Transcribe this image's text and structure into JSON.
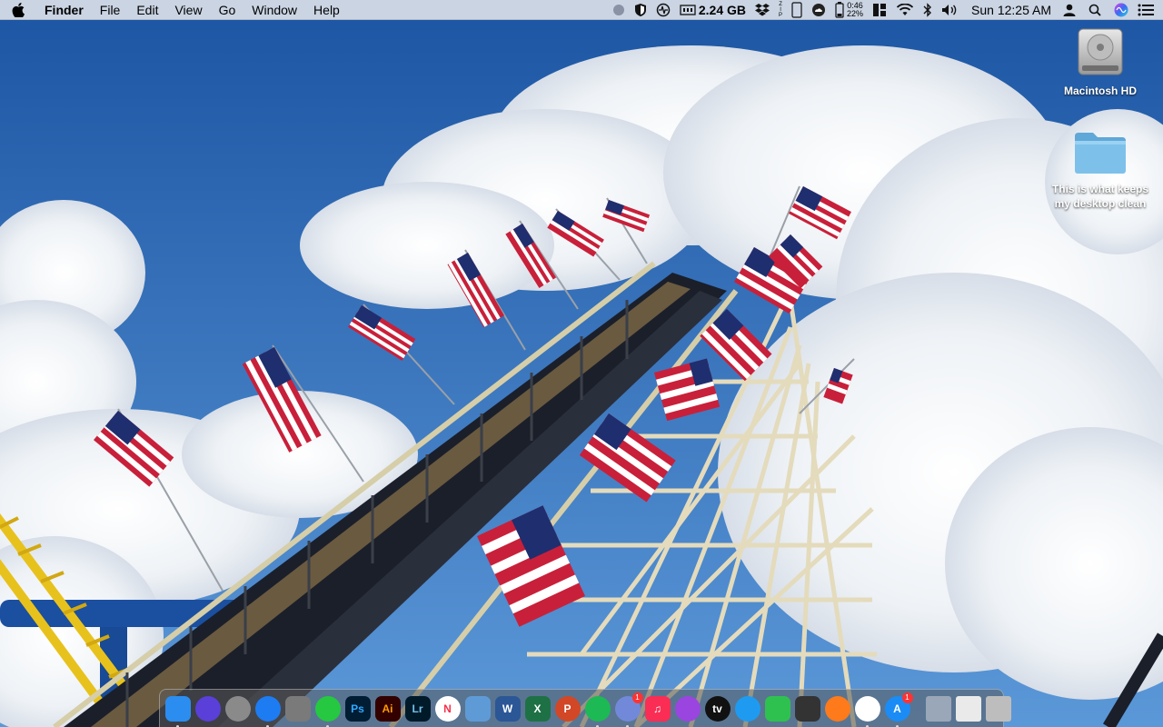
{
  "menubar": {
    "app_name": "Finder",
    "menus": [
      "File",
      "Edit",
      "View",
      "Go",
      "Window",
      "Help"
    ],
    "memory": "2.24 GB",
    "battery_time": "0:46",
    "battery_percent": "22%",
    "clock": "Sun 12:25 AM",
    "status_icons": [
      "record-icon",
      "shield-icon",
      "activity-monitor-icon",
      "memory-icon",
      "dropbox-icon",
      "zip-icon",
      "phone-icon",
      "cloud-sync-icon",
      "battery-icon",
      "window-grid-icon",
      "wifi-icon",
      "bluetooth-icon",
      "volume-icon",
      "user-icon",
      "spotlight-search-icon",
      "siri-icon",
      "notification-center-icon"
    ]
  },
  "desktop": {
    "drive_label": "Macintosh HD",
    "folder_label": "This is what keeps\nmy desktop clean"
  },
  "dock": {
    "apps": [
      {
        "name": "finder",
        "glyph": "",
        "bg": "#2b8df0",
        "running": true
      },
      {
        "name": "siri",
        "glyph": "",
        "bg": "#5a3fd8",
        "running": false,
        "circle": true
      },
      {
        "name": "launchpad",
        "glyph": "",
        "bg": "#8a8a8a",
        "running": false,
        "circle": true
      },
      {
        "name": "safari",
        "glyph": "",
        "bg": "#1d7cf2",
        "running": true,
        "circle": true
      },
      {
        "name": "system-preferences",
        "glyph": "",
        "bg": "#7a7a7a",
        "running": false
      },
      {
        "name": "cloud-app",
        "glyph": "",
        "bg": "#25c840",
        "running": true,
        "circle": true
      },
      {
        "name": "photoshop",
        "glyph": "Ps",
        "bg": "#001d34",
        "fg": "#31a8ff",
        "running": false
      },
      {
        "name": "illustrator",
        "glyph": "Ai",
        "bg": "#330000",
        "fg": "#ff9a00",
        "running": false
      },
      {
        "name": "lightroom",
        "glyph": "Lr",
        "bg": "#001a2a",
        "fg": "#74c0e8",
        "running": false
      },
      {
        "name": "news",
        "glyph": "N",
        "bg": "#ffffff",
        "fg": "#f5304a",
        "running": false,
        "circle": true
      },
      {
        "name": "preview",
        "glyph": "",
        "bg": "#5e9bd6",
        "running": false
      },
      {
        "name": "word",
        "glyph": "W",
        "bg": "#2b5797",
        "running": false
      },
      {
        "name": "excel",
        "glyph": "X",
        "bg": "#1e7145",
        "running": false
      },
      {
        "name": "powerpoint",
        "glyph": "P",
        "bg": "#d24726",
        "running": false,
        "circle": true
      },
      {
        "name": "spotify",
        "glyph": "",
        "bg": "#1db954",
        "running": true,
        "circle": true
      },
      {
        "name": "discord",
        "glyph": "",
        "bg": "#7289da",
        "running": true,
        "circle": true,
        "badge": "1"
      },
      {
        "name": "music",
        "glyph": "♫",
        "bg": "#fa2d55",
        "running": false
      },
      {
        "name": "podcasts",
        "glyph": "",
        "bg": "#9b45e0",
        "running": false,
        "circle": true
      },
      {
        "name": "apple-tv",
        "glyph": "tv",
        "bg": "#111111",
        "running": false,
        "circle": true
      },
      {
        "name": "messages",
        "glyph": "",
        "bg": "#1e9bf0",
        "running": false,
        "circle": true
      },
      {
        "name": "facetime",
        "glyph": "",
        "bg": "#2ec14f",
        "running": false
      },
      {
        "name": "photo-booth",
        "glyph": "",
        "bg": "#333333",
        "running": false
      },
      {
        "name": "maps",
        "glyph": "",
        "bg": "#ff7a1a",
        "running": false,
        "circle": true
      },
      {
        "name": "photos",
        "glyph": "",
        "bg": "#ffffff",
        "running": true,
        "circle": true
      },
      {
        "name": "app-store",
        "glyph": "A",
        "bg": "#1b8cf5",
        "running": true,
        "circle": true,
        "badge": "1"
      }
    ],
    "right_items": [
      {
        "name": "screenshot-folder",
        "bg": "#9aa7b8"
      },
      {
        "name": "downloads-stack",
        "bg": "#eaeaea"
      },
      {
        "name": "trash",
        "bg": "#bdbdbd"
      }
    ]
  },
  "colors": {
    "sky_top": "#1e5aa8",
    "sky_bottom": "#4c8fd6",
    "cloud": "#f4f6f8",
    "track_wood": "#d9cfa8",
    "menubar_bg": "#f0f0f0"
  }
}
